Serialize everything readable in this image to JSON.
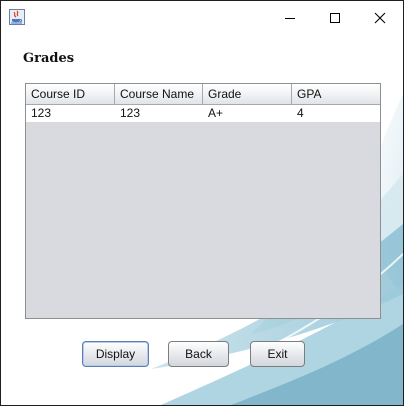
{
  "window": {
    "icons": {
      "app": "java-app-icon",
      "minimize": "minimize-icon",
      "maximize": "maximize-icon",
      "close": "close-icon"
    }
  },
  "page": {
    "title": "Grades"
  },
  "table": {
    "columns": [
      "Course ID",
      "Course Name",
      "Grade",
      "GPA"
    ],
    "rows": [
      [
        "123",
        "123",
        "A+",
        "4"
      ]
    ]
  },
  "buttons": {
    "display": "Display",
    "back": "Back",
    "exit": "Exit"
  },
  "colors": {
    "table_empty_bg": "#d9dadf",
    "focus_border": "#5b7db6"
  }
}
